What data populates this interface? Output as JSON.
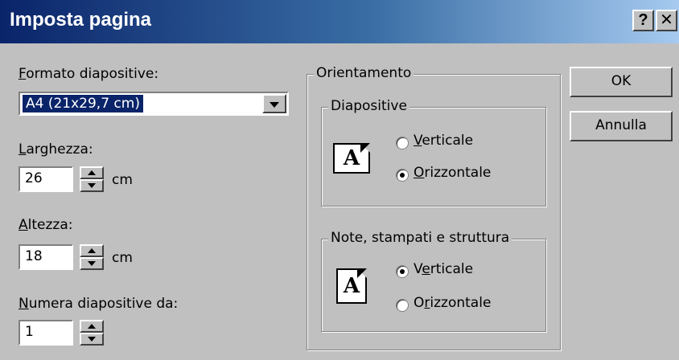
{
  "window": {
    "title": "Imposta pagina",
    "help_glyph": "?",
    "close_glyph": "✕"
  },
  "format": {
    "label_u": "F",
    "label_rest": "ormato diapositive:",
    "selected": "A4 (21x29,7 cm)"
  },
  "width": {
    "label_u": "L",
    "label_rest": "arghezza:",
    "value": "26",
    "unit": "cm"
  },
  "height": {
    "label_u": "A",
    "label_rest": "ltezza:",
    "value": "18",
    "unit": "cm"
  },
  "numbering": {
    "label_u": "N",
    "label_rest": "umera diapositive da:",
    "value": "1"
  },
  "orientation": {
    "title": "Orientamento",
    "slides": {
      "title": "Diapositive",
      "icon_letter": "A",
      "portrait_u": "V",
      "portrait_rest": "erticale",
      "landscape_u": "O",
      "landscape_rest": "rizzontale",
      "selected": "landscape"
    },
    "notes": {
      "title": "Note, stampati e struttura",
      "icon_letter": "A",
      "portrait_pre": "V",
      "portrait_u": "e",
      "portrait_rest": "rticale",
      "landscape_pre": "O",
      "landscape_u": "r",
      "landscape_rest": "izzontale",
      "selected": "portrait"
    }
  },
  "buttons": {
    "ok": "OK",
    "cancel": "Annulla"
  }
}
